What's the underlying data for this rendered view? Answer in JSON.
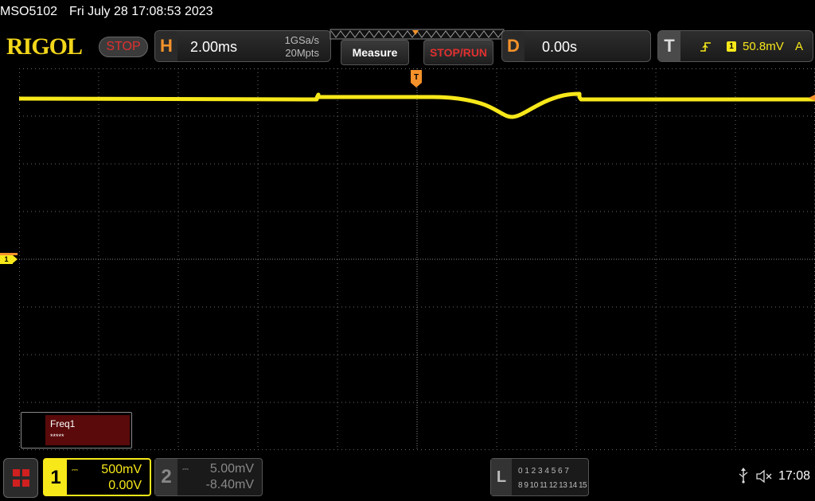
{
  "title_bar": {
    "model": "MSO5102",
    "datetime": "Fri July 28 17:08:53 2023"
  },
  "brand": {
    "logo": "RIGOL",
    "run_state": "STOP"
  },
  "horizontal": {
    "tag": "H",
    "timebase": "2.00ms",
    "sample_rate": "1GSa/s",
    "memory_depth": "20Mpts"
  },
  "toolbar": {
    "measure_label": "Measure",
    "stop_run_label": "STOP/RUN"
  },
  "delay": {
    "tag": "D",
    "value": "0.00s"
  },
  "trigger": {
    "tag": "T",
    "source": "1",
    "level": "50.8mV",
    "mode": "A",
    "marker": "T"
  },
  "channels": [
    {
      "num": "1",
      "scale": "500mV",
      "offset": "0.00V",
      "color": "#f7e81a",
      "active": true
    },
    {
      "num": "2",
      "scale": "5.00mV",
      "offset": "-8.40mV",
      "color": "#888888",
      "active": false
    }
  ],
  "channel_marker": "1",
  "la": {
    "tag": "L",
    "row1": "0 1 2 3  4 5 6 7",
    "row2": "8 9 10 11 12 13 14 15"
  },
  "measure_result": {
    "name": "Freq1",
    "value": "*****"
  },
  "status": {
    "time": "17:08"
  },
  "colors": {
    "trace": "#f7e81a",
    "accent_orange": "#f5922b",
    "stop_red": "#e03030",
    "grid": "#6a6a6a"
  }
}
